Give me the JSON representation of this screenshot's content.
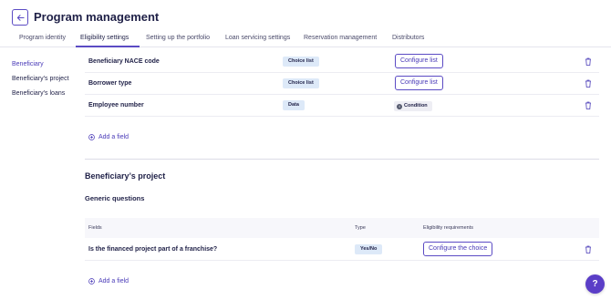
{
  "header": {
    "title": "Program management",
    "back_icon": "arrow-left-icon"
  },
  "tabs": [
    {
      "label": "Program identity",
      "active": false
    },
    {
      "label": "Eligibility settings",
      "active": true
    },
    {
      "label": "Setting up the portfolio",
      "active": false
    },
    {
      "label": "Loan servicing settings",
      "active": false
    },
    {
      "label": "Reservation management",
      "active": false
    },
    {
      "label": "Distributors",
      "active": false
    }
  ],
  "sidebar": {
    "items": [
      {
        "label": "Beneficiary",
        "active": true
      },
      {
        "label": "Beneficiary’s project",
        "active": false
      },
      {
        "label": "Beneficiary’s loans",
        "active": false
      }
    ]
  },
  "beneficiary_rows": [
    {
      "label": "Beneficiary NACE code",
      "type": "Choice list",
      "action": "Configure list"
    },
    {
      "label": "Borrower type",
      "type": "Choice list",
      "action": "Configure list"
    },
    {
      "label": "Employee number",
      "type": "Data",
      "condition": "Condition"
    }
  ],
  "add_field_label": "Add a field",
  "project_section": {
    "title": "Beneficiary’s project",
    "subtitle": "Generic questions",
    "table_headers": {
      "fields": "Fields",
      "type": "Type",
      "requirements": "Eligibility requirements"
    },
    "rows": [
      {
        "label": "Is the financed project part of a franchise?",
        "type": "Yes/No",
        "action": "Configure the choice"
      }
    ],
    "add_field_label": "Add a field"
  },
  "help_button": "?",
  "colors": {
    "accent": "#5b4bc4",
    "chip_bg": "#dde9f8",
    "help_bg": "#5b3ec7"
  }
}
